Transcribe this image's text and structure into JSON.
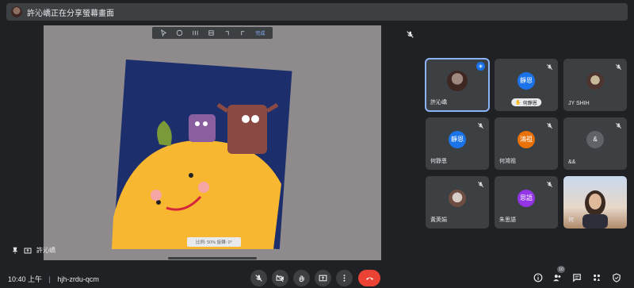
{
  "banner": {
    "text": "許沁嶠正在分享螢幕畫面"
  },
  "presentation": {
    "toolbar": {
      "done_label": "完成"
    },
    "zoom_label": "比例: 50%  旋轉: 0°",
    "presenter_name": "許沁嶠"
  },
  "tiles": [
    {
      "name": "許沁嶠",
      "kind": "photo",
      "speaking": true
    },
    {
      "name": "",
      "kind": "avatar",
      "initials": "靜恩",
      "color": "#1a73e8",
      "hand_label": "何靜恩"
    },
    {
      "name": "JY SHIH",
      "kind": "photo"
    },
    {
      "name": "何靜恩",
      "kind": "avatar",
      "initials": "靜恩",
      "color": "#1a73e8"
    },
    {
      "name": "何鴻祖",
      "kind": "avatar",
      "initials": "鴻祖",
      "color": "#e8710a"
    },
    {
      "name": "&&",
      "kind": "avatar",
      "initials": "&",
      "color": "#5f6368"
    },
    {
      "name": "黃莢娟",
      "kind": "photo"
    },
    {
      "name": "朱思語",
      "kind": "avatar",
      "initials": "思語",
      "color": "#9334e6"
    },
    {
      "name": "何",
      "kind": "video"
    }
  ],
  "footer": {
    "time": "10:40 上午",
    "separator": "|",
    "meeting_code": "hjh-zrdu-qcm",
    "participants_count": "10"
  }
}
